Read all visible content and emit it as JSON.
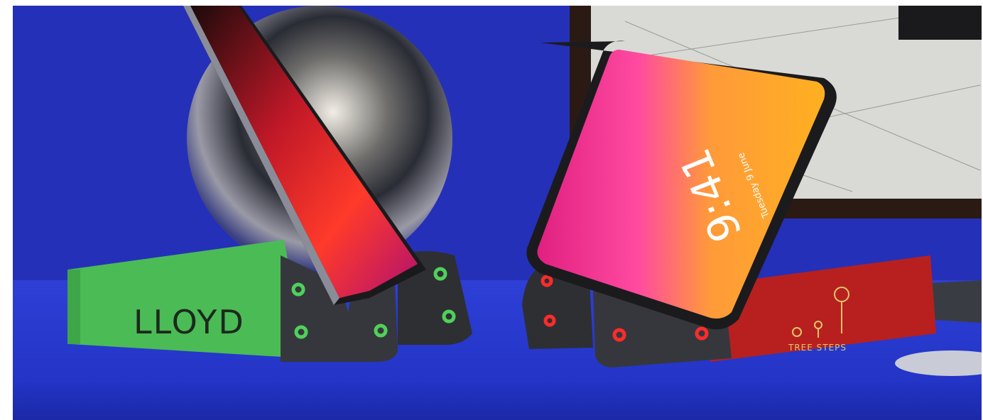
{
  "scene": {
    "description_free": true,
    "colors": {
      "backdrop": "#2530b8",
      "table_top": "#2b3ad0",
      "table_front": "#1f2fb9",
      "green_stand": "#4bbb56",
      "red_stand": "#b7201f",
      "dark_plate": "#2e2f33",
      "sphere": "#8a8a8a",
      "painting": "#d9d9d6"
    }
  },
  "left_stand": {
    "logo_text": "LLOYD",
    "ring_color": "#4fd15a"
  },
  "right_stand": {
    "logo_text": "TREE STEPS",
    "ring_color": "#ff2b2b"
  },
  "right_phone": {
    "clock": "9:41",
    "date": "Tuesday 9 June"
  }
}
